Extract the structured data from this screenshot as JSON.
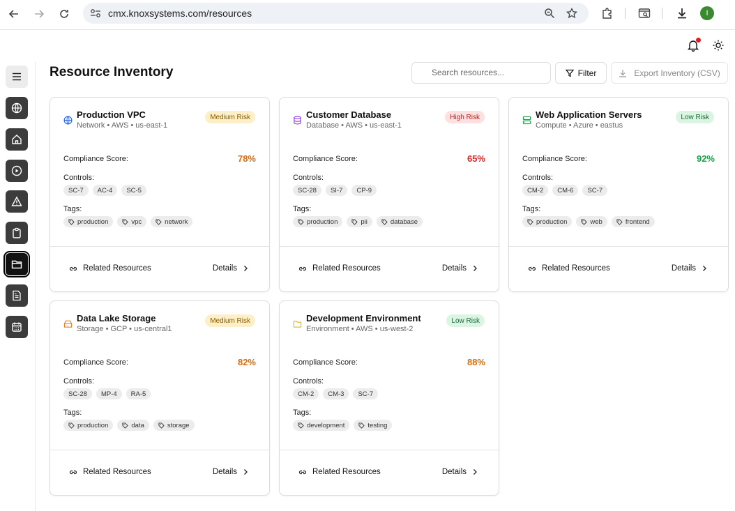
{
  "browser": {
    "url": "cmx.knoxsystems.com/resources",
    "profile_initial": "I"
  },
  "page": {
    "title": "Resource Inventory",
    "search_placeholder": "Search resources...",
    "filter_label": "Filter",
    "export_label": "Export Inventory (CSV)"
  },
  "sidebar": {
    "items": [
      "menu-icon",
      "globe-icon",
      "home-icon",
      "play-icon",
      "alert-icon",
      "clipboard-icon",
      "folder-icon",
      "file-report-icon",
      "calendar-icon"
    ],
    "active": "folder-icon"
  },
  "labels": {
    "compliance": "Compliance Score:",
    "controls": "Controls:",
    "tags": "Tags:",
    "related": "Related Resources",
    "details": "Details"
  },
  "colors": {
    "score_orange": "#dc6c0e",
    "score_red": "#dc2626",
    "score_green": "#16a34a"
  },
  "cards": [
    {
      "icon": "globe-icon",
      "title": "Production VPC",
      "subtitle": "Network • AWS • us-east-1",
      "risk": "Medium Risk",
      "score": "78%",
      "controls": [
        "SC-7",
        "AC-4",
        "SC-5"
      ],
      "tags": [
        "production",
        "vpc",
        "network"
      ]
    },
    {
      "icon": "database-icon",
      "title": "Customer Database",
      "subtitle": "Database • AWS • us-east-1",
      "risk": "High Risk",
      "score": "65%",
      "controls": [
        "SC-28",
        "SI-7",
        "CP-9"
      ],
      "tags": [
        "production",
        "pii",
        "database"
      ]
    },
    {
      "icon": "server-icon",
      "title": "Web Application Servers",
      "subtitle": "Compute • Azure • eastus",
      "risk": "Low Risk",
      "score": "92%",
      "controls": [
        "CM-2",
        "CM-6",
        "SC-7"
      ],
      "tags": [
        "production",
        "web",
        "frontend"
      ]
    },
    {
      "icon": "storage-icon",
      "title": "Data Lake Storage",
      "subtitle": "Storage • GCP • us-central1",
      "risk": "Medium Risk",
      "score": "82%",
      "controls": [
        "SC-28",
        "MP-4",
        "RA-5"
      ],
      "tags": [
        "production",
        "data",
        "storage"
      ]
    },
    {
      "icon": "folder-icon",
      "title": "Development Environment",
      "subtitle": "Environment • AWS • us-west-2",
      "risk": "Low Risk",
      "score": "88%",
      "controls": [
        "CM-2",
        "CM-3",
        "SC-7"
      ],
      "tags": [
        "development",
        "testing"
      ]
    }
  ]
}
